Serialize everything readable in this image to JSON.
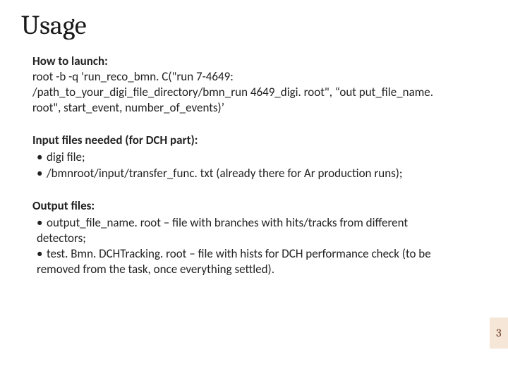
{
  "title": "Usage",
  "launch": {
    "heading": "How to launch:",
    "command": "root -b -q 'run_reco_bmn. C(\"run 7-4649: /path_to_your_digi_file_directory/bmn_run 4649_digi. root\", “out put_file_name. root\", start_event, number_of_events)’"
  },
  "input": {
    "heading": "Input files needed (for DCH part):",
    "items": [
      "digi file;",
      "/bmnroot/input/transfer_func. txt (already there for Ar production runs);"
    ]
  },
  "output": {
    "heading": "Output files:",
    "items": [
      "output_file_name. root – file with branches with hits/tracks from different detectors;",
      "test. Bmn. DCHTracking. root – file with hists for DCH performance check (to be removed from the task, once everything settled)."
    ]
  },
  "page_number": "3"
}
